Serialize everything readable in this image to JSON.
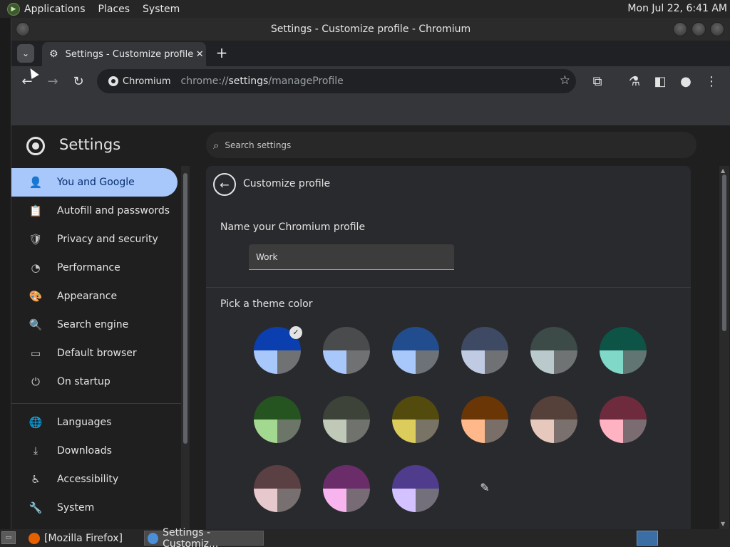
{
  "top_panel": {
    "menus": [
      "Applications",
      "Places",
      "System"
    ],
    "clock": "Mon Jul 22,  6:41 AM"
  },
  "window": {
    "title": "Settings - Customize profile - Chromium"
  },
  "tabs": [
    {
      "label": "Settings - Customize profile",
      "close": "✕",
      "active": true
    }
  ],
  "new_tab_label": "+",
  "toolbar": {
    "site_chip": "Chromium",
    "url_scheme": "chrome://",
    "url_host": "settings",
    "url_path": "/manageProfile"
  },
  "settings": {
    "title": "Settings",
    "search_placeholder": "Search settings",
    "nav": [
      {
        "label": "You and Google",
        "icon": "person-icon",
        "glyph": "👤",
        "active": true
      },
      {
        "label": "Autofill and passwords",
        "icon": "clipboard-icon",
        "glyph": "📋",
        "active": false
      },
      {
        "label": "Privacy and security",
        "icon": "shield-icon",
        "glyph": "🛡",
        "active": false
      },
      {
        "label": "Performance",
        "icon": "speedometer-icon",
        "glyph": "◔",
        "active": false
      },
      {
        "label": "Appearance",
        "icon": "palette-icon",
        "glyph": "🎨",
        "active": false
      },
      {
        "label": "Search engine",
        "icon": "search-icon",
        "glyph": "🔍",
        "active": false
      },
      {
        "label": "Default browser",
        "icon": "browser-icon",
        "glyph": "▭",
        "active": false
      },
      {
        "label": "On startup",
        "icon": "power-icon",
        "glyph": "⏻",
        "active": false
      },
      {
        "label": "Languages",
        "icon": "globe-icon",
        "glyph": "🌐",
        "active": false
      },
      {
        "label": "Downloads",
        "icon": "download-icon",
        "glyph": "⤓",
        "active": false
      },
      {
        "label": "Accessibility",
        "icon": "accessibility-icon",
        "glyph": "♿",
        "active": false
      },
      {
        "label": "System",
        "icon": "wrench-icon",
        "glyph": "🔧",
        "active": false
      }
    ],
    "page_title": "Customize profile",
    "name_label": "Name your Chromium profile",
    "name_value": "Work",
    "theme_label": "Pick a theme color",
    "swatches": [
      {
        "top": "#0b3fb0",
        "bl": "#a8c7fa",
        "br": "#6f7173",
        "selected": true
      },
      {
        "top": "#4a4b4d",
        "bl": "#a8c7fa",
        "br": "#6f7173",
        "selected": false
      },
      {
        "top": "#214d8f",
        "bl": "#a8c7fa",
        "br": "#6d7178",
        "selected": false
      },
      {
        "top": "#3e4a63",
        "bl": "#c0cbe3",
        "br": "#6f7174",
        "selected": false
      },
      {
        "top": "#3c4a48",
        "bl": "#bac9cc",
        "br": "#6f7373",
        "selected": false
      },
      {
        "top": "#0d5447",
        "bl": "#7fd8c8",
        "br": "#617672",
        "selected": false
      },
      {
        "top": "#265421",
        "bl": "#a3d890",
        "br": "#6c7668",
        "selected": false
      },
      {
        "top": "#3d4339",
        "bl": "#c0c9b8",
        "br": "#6f726d",
        "selected": false
      },
      {
        "top": "#534b0e",
        "bl": "#dccc5c",
        "br": "#787364",
        "selected": false
      },
      {
        "top": "#6a3606",
        "bl": "#ffb889",
        "br": "#7a6f68",
        "selected": false
      },
      {
        "top": "#56403a",
        "bl": "#e6c8bd",
        "br": "#7a706d",
        "selected": false
      },
      {
        "top": "#6e2b3e",
        "bl": "#ffb2c2",
        "br": "#7a6c70",
        "selected": false
      },
      {
        "top": "#5a3f43",
        "bl": "#e7c8cc",
        "br": "#776f70",
        "selected": false
      },
      {
        "top": "#6a2d69",
        "bl": "#f8b4ef",
        "br": "#776c76",
        "selected": false
      },
      {
        "top": "#4f3c8d",
        "bl": "#d3c2ff",
        "br": "#736f7b",
        "selected": false
      }
    ]
  },
  "taskbar": {
    "items": [
      {
        "label": "[Mozilla Firefox]",
        "active": false
      },
      {
        "label": "Settings - Customiz...",
        "active": true
      }
    ]
  },
  "colors": {
    "accent": "#a8c7fa",
    "accent_text": "#062e6f",
    "background": "#1f1f1f",
    "card": "#292a2d"
  }
}
